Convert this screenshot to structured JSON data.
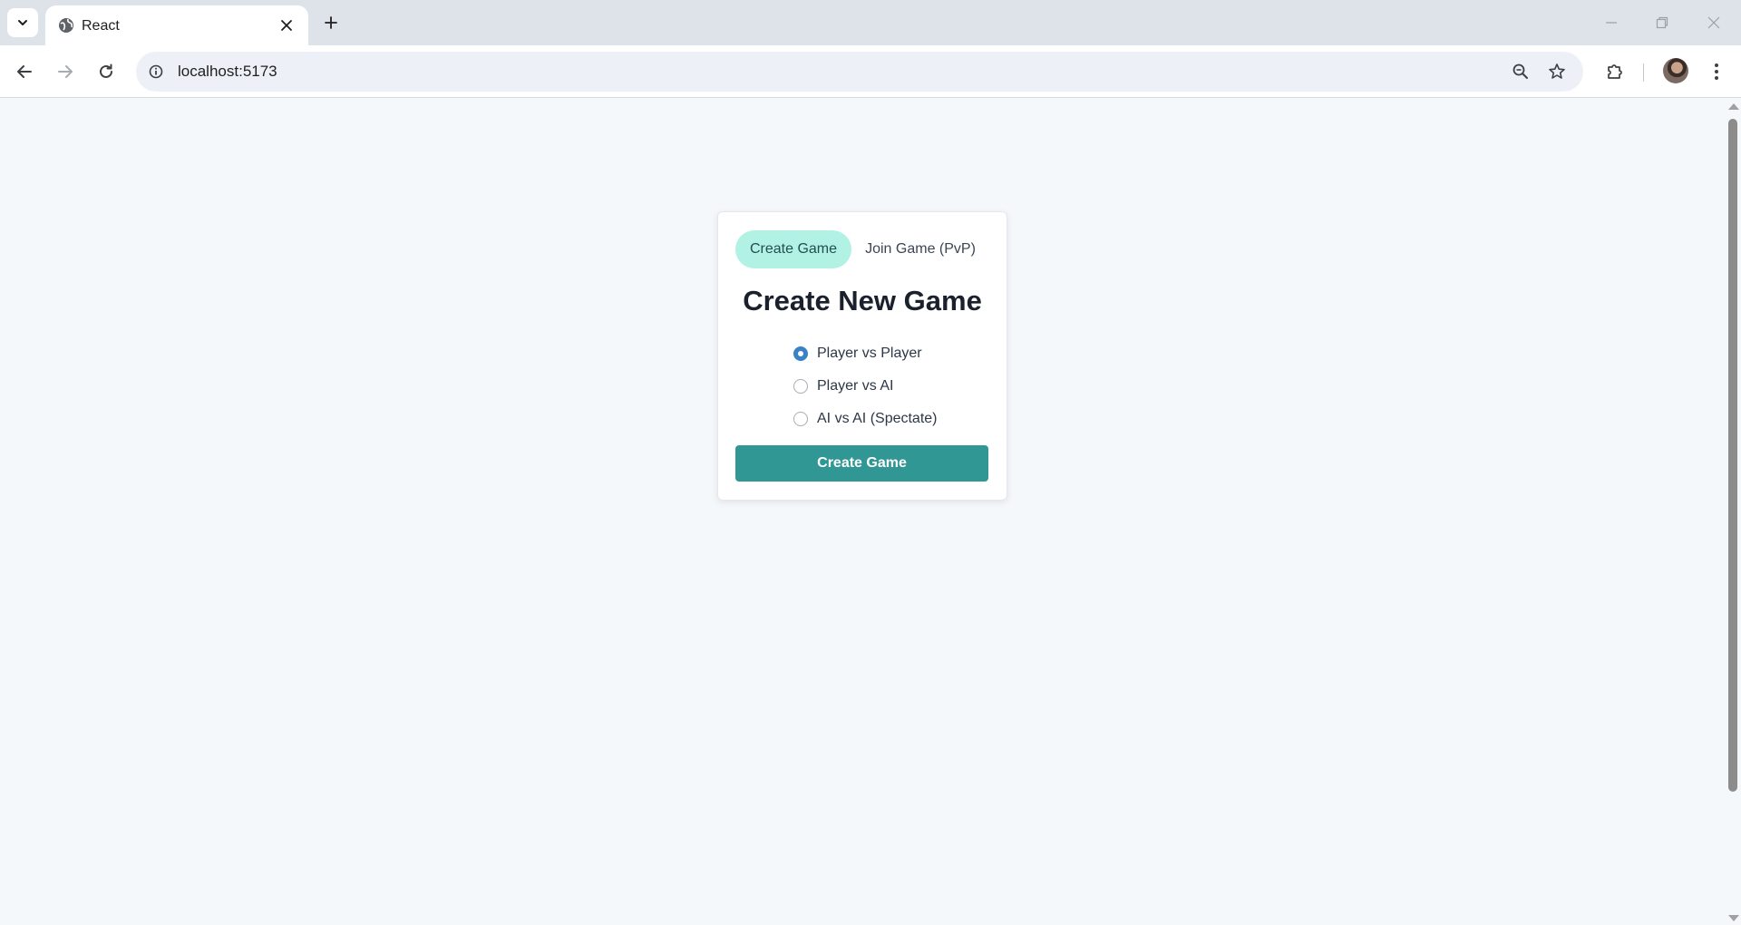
{
  "browser": {
    "tab_title": "React",
    "url": "localhost:5173",
    "icons": {
      "tab_search": "chevron-down-icon",
      "favicon": "globe-icon",
      "tab_close": "close-icon",
      "new_tab": "plus-icon",
      "minimize": "minimize-icon",
      "restore": "restore-icon",
      "close_window": "close-icon",
      "back": "arrow-left-icon",
      "forward": "arrow-right-icon",
      "reload": "reload-icon",
      "site_info": "info-icon",
      "zoom": "zoom-out-icon",
      "bookmark": "star-icon",
      "extensions": "puzzle-icon",
      "menu": "more-vertical-icon"
    }
  },
  "game_setup": {
    "tabs": [
      {
        "label": "Create Game",
        "active": true
      },
      {
        "label": "Join Game (PvP)",
        "active": false
      }
    ],
    "title": "Create New Game",
    "modes": [
      {
        "label": "Player vs Player",
        "selected": true
      },
      {
        "label": "Player vs AI",
        "selected": false
      },
      {
        "label": "AI vs AI (Spectate)",
        "selected": false
      }
    ],
    "submit_label": "Create Game"
  },
  "colors": {
    "page_background": "#f5f8fb",
    "active_tab": "#b2f2e5",
    "primary_button": "#319795",
    "radio_accent": "#3b82c4"
  }
}
